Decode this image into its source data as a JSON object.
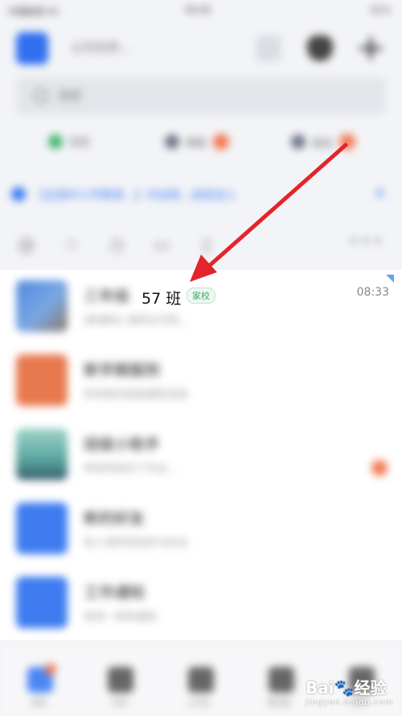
{
  "status_bar": {
    "carrier": "中国联通 4G",
    "time": "08:48",
    "battery": "61%"
  },
  "header": {
    "org_name": "公司名称…"
  },
  "search": {
    "placeholder": "搜索"
  },
  "quick_tabs": [
    {
      "label": "日历",
      "color": "#3fb76a"
    },
    {
      "label": "审批",
      "color": "#6b7388"
    },
    {
      "label": "会议",
      "color": "#6b7388"
    }
  ],
  "banner": {
    "text": "【全国中小学教育…】开启网…成就加入"
  },
  "filter_icons": [
    "at-icon",
    "star-icon",
    "clock-icon",
    "bookmark-icon",
    "file-icon",
    "more-icon"
  ],
  "chats": [
    {
      "title_blurred": "三年级",
      "title_visible": "57 班",
      "tag": "家校",
      "subtitle": "[群通知] 请家长尽快…",
      "time": "08:33",
      "unread": false
    },
    {
      "title_blurred": "新学期报到",
      "subtitle": "您有新的班级通知消息",
      "time": "",
      "unread": false
    },
    {
      "title_blurred": "班级小助手",
      "subtitle": "李老师发布了作业…",
      "time": "",
      "unread": true
    },
    {
      "title_blurred": "新的好友",
      "subtitle": "有人请求添加你为好友",
      "time": "",
      "unread": false
    },
    {
      "title_blurred": "工作通知",
      "subtitle": "收到一条新通知",
      "time": "",
      "unread": false
    }
  ],
  "tabbar": [
    "消息",
    "文档",
    "工作台",
    "通讯录",
    "我的"
  ],
  "colors": {
    "accent": "#3d7bf5",
    "badge": "#f37852",
    "tag_green": "#3fa766",
    "annotation_red": "#e3252b"
  }
}
